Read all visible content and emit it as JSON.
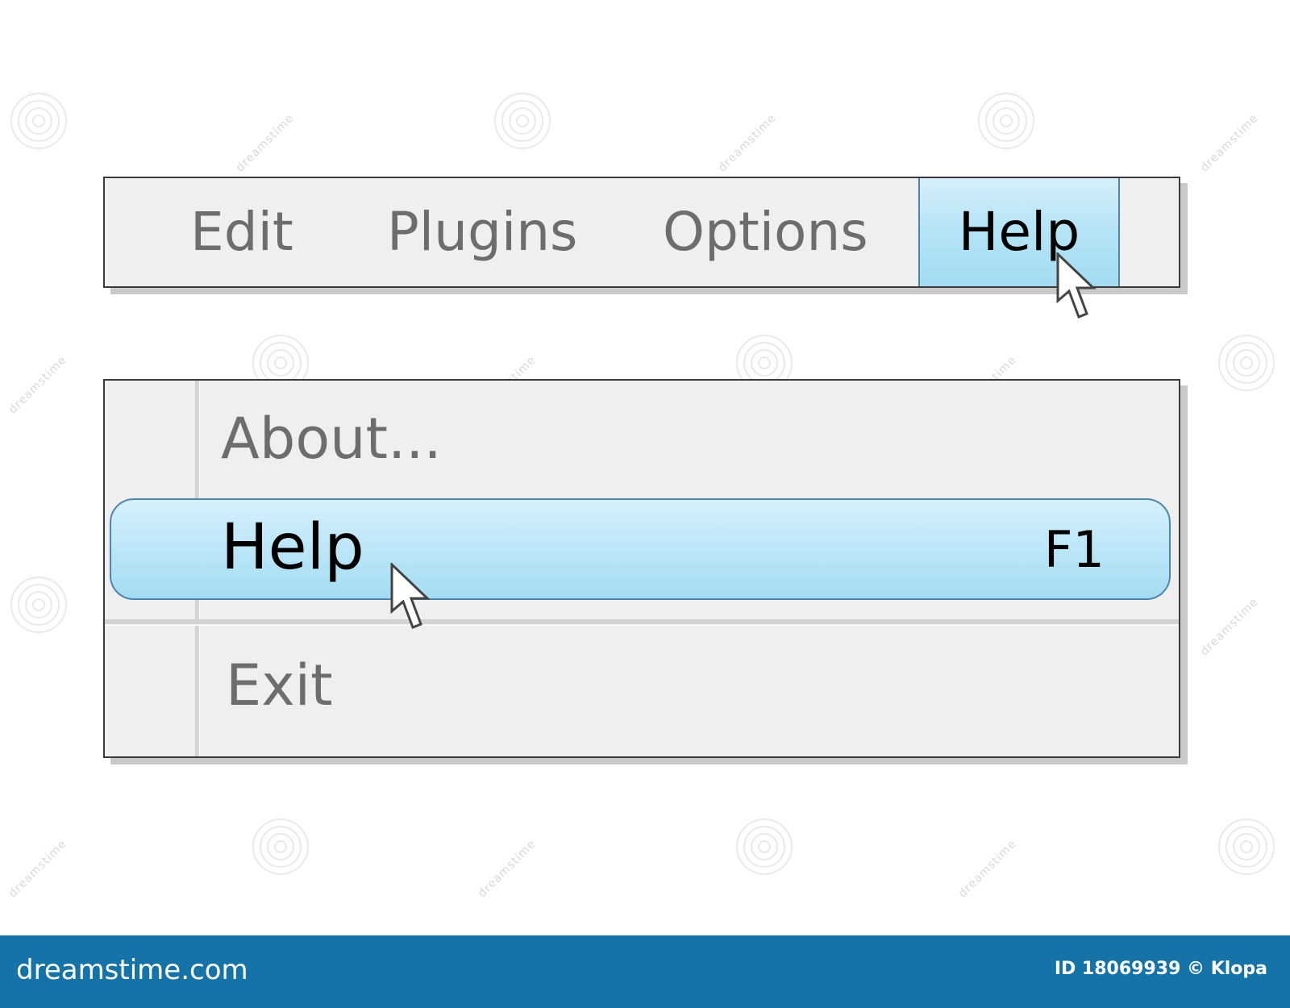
{
  "menubar": {
    "items": [
      {
        "label": "Edit"
      },
      {
        "label": "Plugins"
      },
      {
        "label": "Options"
      },
      {
        "label": "Help"
      }
    ],
    "active_item": "Help"
  },
  "dropdown": {
    "items": [
      {
        "label": "About..."
      },
      {
        "label": "Help",
        "shortcut": "F1"
      },
      {
        "label": "Exit"
      }
    ],
    "highlighted_item": "Help"
  },
  "watermark": {
    "text": "dreamstime"
  },
  "footer": {
    "brand": "dreamstime.com",
    "image_id": "ID 18069939 © Klopa"
  },
  "colors": {
    "menu_background": "#efefef",
    "highlight_top": "#d6f0fb",
    "highlight_bottom": "#a5dcf3",
    "highlight_border": "#4d86ad",
    "inactive_text": "#6d6d6d",
    "active_text": "#000000",
    "footer_background": "#1673a7"
  },
  "icons": {
    "cursor": "arrow-pointer-icon",
    "watermark_swirl": "spiral-icon"
  }
}
